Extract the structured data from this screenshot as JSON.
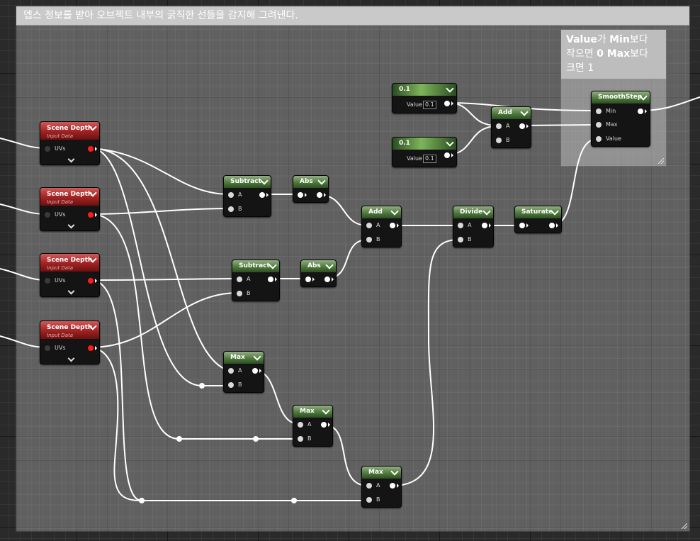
{
  "comments": {
    "main": "뎁스 정보를 받아 오브젝트 내부의 굵직한 선들을 감지해 그려낸다.",
    "smoothstep_note": {
      "line1_a": "Value",
      "line1_b": "가 ",
      "line1_c": "Min",
      "line1_d": "보다",
      "line2_a": "작으면 ",
      "line2_b": "0 Max",
      "line2_c": "보다",
      "line3": "크면 1"
    }
  },
  "nodes": {
    "scene_depth_title": "Scene Depth",
    "scene_depth_subtitle": "Input Data",
    "uvs": "UVs",
    "subtract": "Subtract",
    "abs": "Abs",
    "add": "Add",
    "divide": "Divide",
    "saturate": "Saturate",
    "max": "Max",
    "smoothstep": "SmoothStep",
    "const_title": "0.1",
    "const_value_label": "Value",
    "const_value": "0.1",
    "pin_a": "A",
    "pin_b": "B",
    "pin_min": "Min",
    "pin_max": "Max",
    "pin_value": "Value"
  },
  "colors": {
    "scene_depth_header": "#a42525",
    "math_header": "#4e7b3c",
    "wire": "#ffffff",
    "uv_output_pin": "#ff1a1a"
  }
}
